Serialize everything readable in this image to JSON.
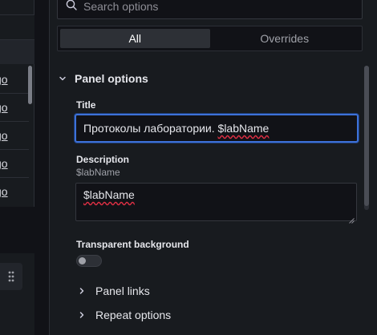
{
  "left_panel": {
    "rows": [
      {
        "text": "go"
      },
      {
        "text": "go"
      },
      {
        "text": "go"
      },
      {
        "text": "go"
      },
      {
        "text": "go"
      }
    ]
  },
  "options": {
    "search": {
      "placeholder": "Search options",
      "value": ""
    },
    "tabs": [
      {
        "label": "All",
        "active": true
      },
      {
        "label": "Overrides",
        "active": false
      }
    ],
    "section": {
      "title": "Panel options",
      "expanded": true,
      "title_field": {
        "label": "Title",
        "value_prefix": "Протоколы лаборатории. ",
        "value_var": "$labName"
      },
      "description_field": {
        "label": "Description",
        "hint": "$labName",
        "value": "$labName"
      },
      "transparent_background": {
        "label": "Transparent background",
        "enabled": false
      },
      "subsections": [
        {
          "label": "Panel links",
          "expanded": false
        },
        {
          "label": "Repeat options",
          "expanded": false
        }
      ]
    }
  },
  "colors": {
    "background": "#111217",
    "panel": "#181b1f",
    "focus_border": "#3d71d9",
    "spellcheck": "#e02f44"
  }
}
